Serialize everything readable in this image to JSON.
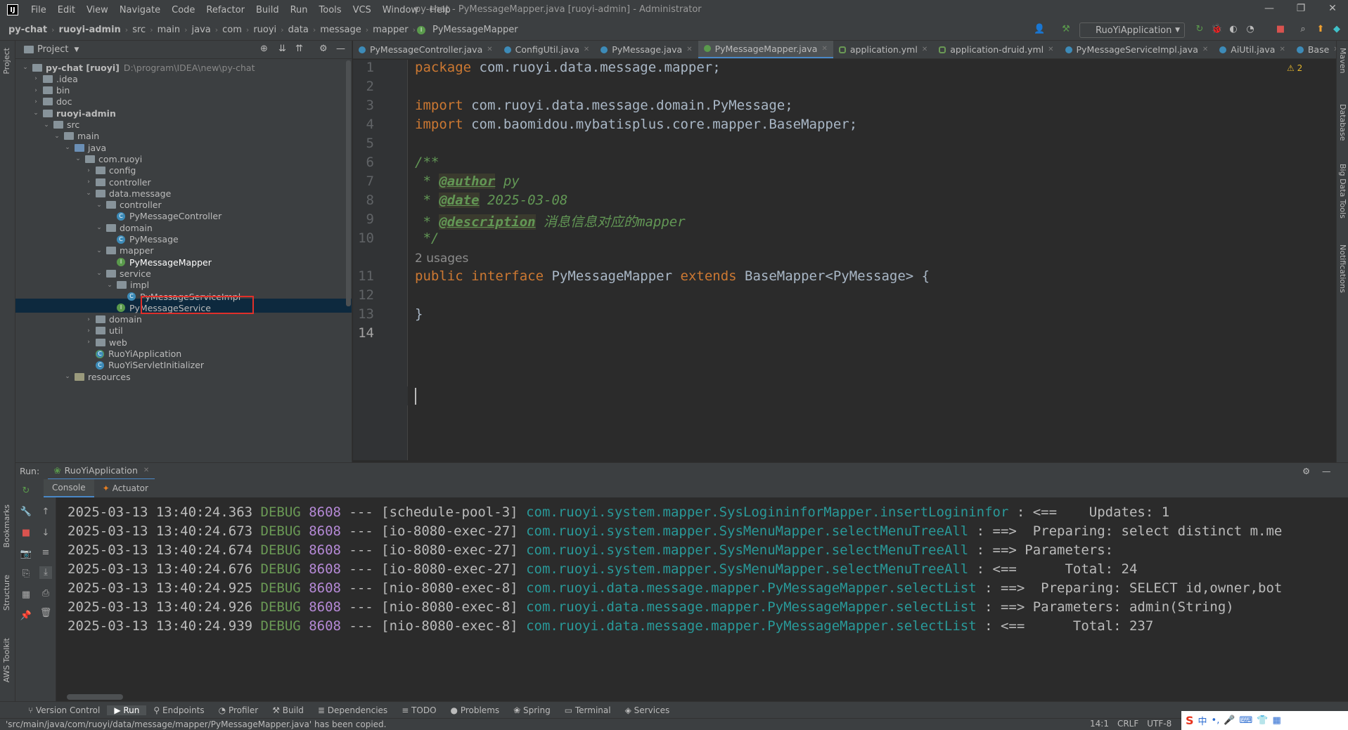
{
  "titlebar": {
    "logo": "IJ",
    "menu": [
      "File",
      "Edit",
      "View",
      "Navigate",
      "Code",
      "Refactor",
      "Build",
      "Run",
      "Tools",
      "VCS",
      "Window",
      "Help"
    ],
    "title": "py-chat - PyMessageMapper.java [ruoyi-admin] - Administrator",
    "minimize": "—",
    "restore": "❐",
    "close": "✕"
  },
  "navbar": {
    "crumbs": [
      "py-chat",
      "ruoyi-admin",
      "src",
      "main",
      "java",
      "com",
      "ruoyi",
      "data",
      "message",
      "mapper",
      "PyMessageMapper"
    ],
    "run_config": "RuoYiApplication"
  },
  "left_stripe": {
    "project": "Project",
    "bookmarks": "Bookmarks",
    "structure": "Structure",
    "aws": "AWS Toolkit"
  },
  "right_stripe": {
    "maven": "Maven",
    "database": "Database",
    "bigdata": "Big Data Tools",
    "notifications": "Notifications"
  },
  "project": {
    "header": "Project",
    "tree": [
      {
        "label": "py-chat [ruoyi]",
        "hint": "D:\\program\\IDEA\\new\\py-chat",
        "depth": 0,
        "kind": "folder",
        "open": true,
        "bold": true
      },
      {
        "label": ".idea",
        "depth": 1,
        "kind": "folder",
        "open": false
      },
      {
        "label": "bin",
        "depth": 1,
        "kind": "folder",
        "open": false
      },
      {
        "label": "doc",
        "depth": 1,
        "kind": "folder",
        "open": false
      },
      {
        "label": "ruoyi-admin",
        "depth": 1,
        "kind": "folder",
        "open": true,
        "bold": true
      },
      {
        "label": "src",
        "depth": 2,
        "kind": "folder",
        "open": true
      },
      {
        "label": "main",
        "depth": 3,
        "kind": "folder",
        "open": true
      },
      {
        "label": "java",
        "depth": 4,
        "kind": "src",
        "open": true
      },
      {
        "label": "com.ruoyi",
        "depth": 5,
        "kind": "folder",
        "open": true
      },
      {
        "label": "config",
        "depth": 6,
        "kind": "folder",
        "open": false
      },
      {
        "label": "controller",
        "depth": 6,
        "kind": "folder",
        "open": false
      },
      {
        "label": "data.message",
        "depth": 6,
        "kind": "folder",
        "open": true
      },
      {
        "label": "controller",
        "depth": 7,
        "kind": "folder",
        "open": true
      },
      {
        "label": "PyMessageController",
        "depth": 8,
        "kind": "class"
      },
      {
        "label": "domain",
        "depth": 7,
        "kind": "folder",
        "open": true
      },
      {
        "label": "PyMessage",
        "depth": 8,
        "kind": "class"
      },
      {
        "label": "mapper",
        "depth": 7,
        "kind": "folder",
        "open": true
      },
      {
        "label": "PyMessageMapper",
        "depth": 8,
        "kind": "interface"
      },
      {
        "label": "service",
        "depth": 7,
        "kind": "folder",
        "open": true
      },
      {
        "label": "impl",
        "depth": 8,
        "kind": "folder",
        "open": true
      },
      {
        "label": "PyMessageServiceImpl",
        "depth": 9,
        "kind": "class"
      },
      {
        "label": "PyMessageService",
        "depth": 8,
        "kind": "interface"
      },
      {
        "label": "domain",
        "depth": 6,
        "kind": "folder",
        "open": false
      },
      {
        "label": "util",
        "depth": 6,
        "kind": "folder",
        "open": false
      },
      {
        "label": "web",
        "depth": 6,
        "kind": "folder",
        "open": false
      },
      {
        "label": "RuoYiApplication",
        "depth": 6,
        "kind": "app"
      },
      {
        "label": "RuoYiServletInitializer",
        "depth": 6,
        "kind": "class"
      },
      {
        "label": "resources",
        "depth": 4,
        "kind": "res",
        "open": true
      }
    ]
  },
  "tabs": [
    {
      "label": "PyMessageController.java",
      "icon": "c"
    },
    {
      "label": "ConfigUtil.java",
      "icon": "c"
    },
    {
      "label": "PyMessage.java",
      "icon": "c"
    },
    {
      "label": "PyMessageMapper.java",
      "icon": "i",
      "active": true
    },
    {
      "label": "application.yml",
      "icon": "y"
    },
    {
      "label": "application-druid.yml",
      "icon": "y"
    },
    {
      "label": "PyMessageServiceImpl.java",
      "icon": "c"
    },
    {
      "label": "AiUtil.java",
      "icon": "c"
    },
    {
      "label": "Base",
      "icon": "c"
    }
  ],
  "editor": {
    "warnings": "⚠ 2",
    "lines": [
      "1",
      "2",
      "3",
      "4",
      "5",
      "6",
      "7",
      "8",
      "9",
      "10",
      "11",
      "12",
      "13",
      "14"
    ],
    "code": {
      "l1_kw": "package",
      "l1_rest": " com.ruoyi.data.message.mapper;",
      "l3_kw": "import",
      "l3_rest": " com.ruoyi.data.message.domain.PyMessage;",
      "l4_kw": "import",
      "l4_rest": " com.baomidou.mybatisplus.core.mapper.BaseMapper;",
      "l6": "/**",
      "l7_tag": "@author",
      "l7_rest": " py",
      "l8_tag": "@date",
      "l8_rest": " 2025-03-08",
      "l9_tag": "@description",
      "l9_rest": " 消息信息对应的mapper",
      "l10": " */",
      "usages": "2 usages",
      "l11_kw1": "public interface",
      "l11_name": " PyMessageMapper ",
      "l11_kw2": "extends",
      "l11_rest": " BaseMapper<PyMessage> {",
      "l13": "}"
    }
  },
  "run": {
    "label": "Run:",
    "config": "RuoYiApplication",
    "subtabs": [
      "Console",
      "Actuator"
    ],
    "logs": [
      {
        "ts": "2025-03-13 13:40:24.363",
        "level": "DEBUG",
        "pid": "8608",
        "thread": "--- [schedule-pool-3]",
        "logger": "com.ruoyi.system.mapper.SysLogininforMapper.insertLogininfor",
        "msg": " : <==    Updates: 1"
      },
      {
        "ts": "2025-03-13 13:40:24.673",
        "level": "DEBUG",
        "pid": "8608",
        "thread": "--- [io-8080-exec-27]",
        "logger": "com.ruoyi.system.mapper.SysMenuMapper.selectMenuTreeAll",
        "msg": " : ==>  Preparing: select distinct m.me"
      },
      {
        "ts": "2025-03-13 13:40:24.674",
        "level": "DEBUG",
        "pid": "8608",
        "thread": "--- [io-8080-exec-27]",
        "logger": "com.ruoyi.system.mapper.SysMenuMapper.selectMenuTreeAll",
        "msg": " : ==> Parameters:"
      },
      {
        "ts": "2025-03-13 13:40:24.676",
        "level": "DEBUG",
        "pid": "8608",
        "thread": "--- [io-8080-exec-27]",
        "logger": "com.ruoyi.system.mapper.SysMenuMapper.selectMenuTreeAll",
        "msg": " : <==      Total: 24"
      },
      {
        "ts": "2025-03-13 13:40:24.925",
        "level": "DEBUG",
        "pid": "8608",
        "thread": "--- [nio-8080-exec-8]",
        "logger": "com.ruoyi.data.message.mapper.PyMessageMapper.selectList",
        "msg": " : ==>  Preparing: SELECT id,owner,bot"
      },
      {
        "ts": "2025-03-13 13:40:24.926",
        "level": "DEBUG",
        "pid": "8608",
        "thread": "--- [nio-8080-exec-8]",
        "logger": "com.ruoyi.data.message.mapper.PyMessageMapper.selectList",
        "msg": " : ==> Parameters: admin(String)"
      },
      {
        "ts": "2025-03-13 13:40:24.939",
        "level": "DEBUG",
        "pid": "8608",
        "thread": "--- [nio-8080-exec-8]",
        "logger": "com.ruoyi.data.message.mapper.PyMessageMapper.selectList",
        "msg": " : <==      Total: 237"
      }
    ]
  },
  "bottom_tools": [
    "Version Control",
    "Run",
    "Endpoints",
    "Profiler",
    "Build",
    "Dependencies",
    "TODO",
    "Problems",
    "Spring",
    "Terminal",
    "Services"
  ],
  "status": {
    "message": "'src/main/java/com/ruoyi/data/message/mapper/PyMessageMapper.java' has been copied.",
    "position": "14:1",
    "line_sep": "CRLF",
    "encoding": "UTF-8",
    "ime": "中"
  }
}
